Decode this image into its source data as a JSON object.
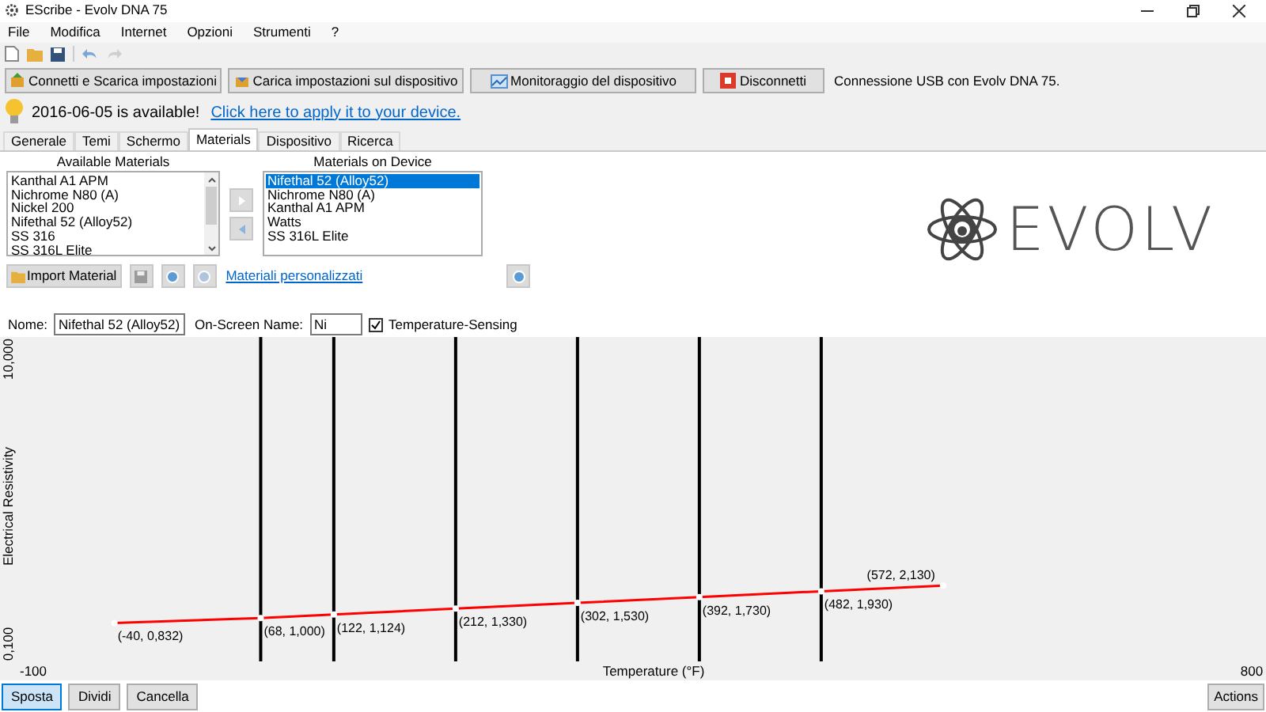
{
  "window": {
    "title": "EScribe - Evolv DNA 75"
  },
  "menu": [
    "File",
    "Modifica",
    "Internet",
    "Opzioni",
    "Strumenti",
    "?"
  ],
  "action_buttons": [
    {
      "label": "Connetti e Scarica impostazioni",
      "kind": "download"
    },
    {
      "label": "Carica impostazioni sul dispositivo",
      "kind": "upload"
    },
    {
      "label": "Monitoraggio del dispositivo",
      "kind": "monitor"
    },
    {
      "label": "Disconnetti",
      "kind": "disconnect"
    }
  ],
  "connection_status": "Connessione USB con Evolv DNA 75.",
  "update_notice": {
    "text": "2016-06-05 is available!",
    "link": "Click here to apply it to your device."
  },
  "tabs": [
    {
      "label": "Generale",
      "selected": false
    },
    {
      "label": "Temi",
      "selected": false
    },
    {
      "label": "Schermo",
      "selected": false
    },
    {
      "label": "Materials",
      "selected": true
    },
    {
      "label": "Dispositivo",
      "selected": false
    },
    {
      "label": "Ricerca",
      "selected": false
    }
  ],
  "available_materials": {
    "title": "Available Materials",
    "items": [
      {
        "label": "Kanthal A1 APM",
        "selected": false
      },
      {
        "label": "Nichrome N80 (A)",
        "selected": false
      },
      {
        "label": "Nickel 200",
        "selected": false
      },
      {
        "label": "Nifethal 52 (Alloy52)",
        "selected": false
      },
      {
        "label": "SS 316",
        "selected": false
      },
      {
        "label": "SS 316L Elite",
        "selected": false
      }
    ]
  },
  "device_materials": {
    "title": "Materials on Device",
    "items": [
      {
        "label": "Nifethal 52 (Alloy52)",
        "selected": true
      },
      {
        "label": "Nichrome N80 (A)",
        "selected": false
      },
      {
        "label": "Kanthal A1 APM",
        "selected": false
      },
      {
        "label": "Watts",
        "selected": false
      },
      {
        "label": "SS 316L Elite",
        "selected": false
      }
    ]
  },
  "import_button": "Import Material",
  "custom_link": "Materiali personalizzati",
  "logo": {
    "text": "EVOLV"
  },
  "name_field": {
    "label": "Nome:",
    "value": "Nifethal 52 (Alloy52)"
  },
  "onscreen_field": {
    "label": "On-Screen Name:",
    "value": "Ni"
  },
  "temperature_sensing": {
    "label": "Temperature-Sensing",
    "checked": true
  },
  "chart": {
    "chart_data": {
      "type": "line",
      "xlabel": "Temperature (°F)",
      "ylabel": "Electrical Resistivity",
      "xlim": [
        -100,
        800
      ],
      "ylim": [
        0.1,
        10
      ],
      "xticks": [
        -100,
        800
      ],
      "yticks": [
        {
          "value": 0.1,
          "label": "0,100"
        },
        {
          "value": 10,
          "label": "10,000"
        }
      ],
      "x": [
        -40,
        68,
        122,
        212,
        302,
        392,
        482,
        572
      ],
      "series": [
        {
          "color": "#ff0000",
          "marker": "circle",
          "values": [
            0.832,
            1.0,
            1.124,
            1.33,
            1.53,
            1.73,
            1.93,
            2.13
          ]
        }
      ],
      "value_labels": [
        "(-40, 0,832)",
        "(68, 1,000)",
        "(122, 1,124)",
        "(212, 1,330)",
        "(302, 1,530)",
        "(392, 1,730)",
        "(482, 1,930)",
        "(572, 2,130)"
      ]
    }
  },
  "bottom_buttons": [
    {
      "label": "Sposta",
      "selected": true
    },
    {
      "label": "Dividi",
      "selected": false
    },
    {
      "label": "Cancella",
      "selected": false
    }
  ],
  "actions_button": "Actions"
}
